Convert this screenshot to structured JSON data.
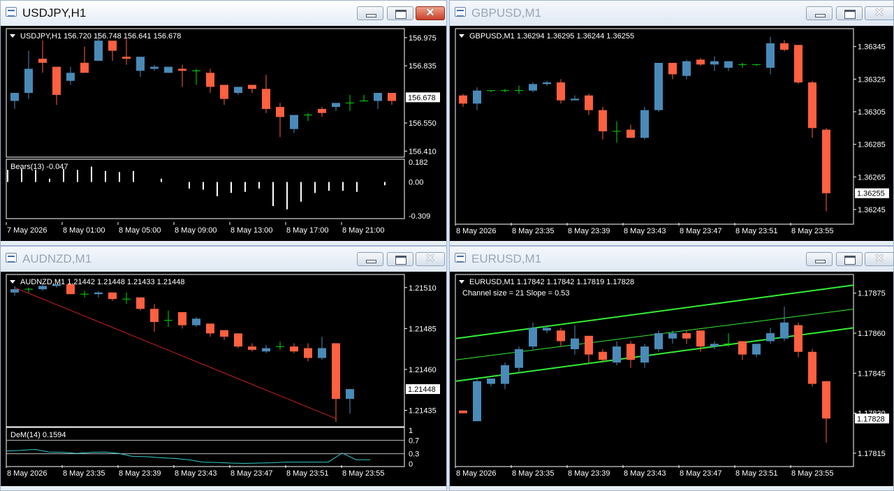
{
  "colors": {
    "bull": "#4a8ab8",
    "bear": "#ff6040",
    "doji": "#00dd00",
    "bg": "#000000",
    "grid": "#ffffff",
    "axis_text": "#ffffff",
    "channel": "#33ee33",
    "trend": "#cc2222",
    "dem": "#33cccc"
  },
  "windows": [
    {
      "id": "usdjpy",
      "title": "USDJPY,H1",
      "active": true,
      "header": "USDJPY,H1  156.720 156.748 156.641 156.678",
      "price_labels": [
        "156.975",
        "156.835",
        "156.550",
        "156.410"
      ],
      "current_price": "156.678",
      "indicator": {
        "label": "Bears(13) -0.047",
        "levels": [
          "0.182",
          "0.00",
          "-0.309"
        ],
        "values": [
          0.11,
          0.12,
          0.11,
          0.03,
          0.12,
          0.11,
          0.14,
          0.1,
          0.09,
          0.1,
          0.0,
          0.03,
          0.0,
          -0.06,
          -0.07,
          -0.13,
          -0.1,
          -0.09,
          -0.06,
          -0.22,
          -0.25,
          -0.18,
          -0.1,
          -0.08,
          -0.08,
          -0.09,
          0.0,
          -0.03,
          0.0
        ]
      },
      "time_labels": [
        "7 May 2026",
        "8 May 01:00",
        "8 May 05:00",
        "8 May 09:00",
        "8 May 13:00",
        "8 May 17:00",
        "8 May 21:00"
      ],
      "ohlc": [
        [
          156.66,
          156.7,
          156.62,
          156.7
        ],
        [
          156.7,
          156.91,
          156.67,
          156.82
        ],
        [
          156.87,
          156.96,
          156.8,
          156.85
        ],
        [
          156.83,
          156.75,
          156.64,
          156.69
        ],
        [
          156.76,
          156.83,
          156.74,
          156.8
        ],
        [
          156.85,
          156.93,
          156.8,
          156.8
        ],
        [
          156.86,
          157.0,
          156.88,
          156.96
        ],
        [
          156.96,
          156.95,
          156.86,
          156.91
        ],
        [
          156.88,
          156.97,
          156.84,
          156.87
        ],
        [
          156.81,
          156.85,
          156.78,
          156.88
        ],
        [
          156.82,
          156.84,
          156.81,
          156.83
        ],
        [
          156.8,
          156.82,
          156.8,
          156.83
        ],
        [
          156.82,
          156.84,
          156.73,
          156.81
        ],
        [
          156.81,
          156.82,
          156.74,
          156.81
        ],
        [
          156.8,
          156.82,
          156.7,
          156.73
        ],
        [
          156.74,
          156.7,
          156.64,
          156.67
        ],
        [
          156.7,
          156.7,
          156.69,
          156.73
        ],
        [
          156.74,
          156.74,
          156.7,
          156.72
        ],
        [
          156.72,
          156.79,
          156.6,
          156.62
        ],
        [
          156.63,
          156.65,
          156.48,
          156.58
        ],
        [
          156.52,
          156.56,
          156.5,
          156.59
        ],
        [
          156.59,
          156.6,
          156.56,
          156.59
        ],
        [
          156.62,
          156.63,
          156.58,
          156.6
        ],
        [
          156.63,
          156.65,
          156.61,
          156.65
        ],
        [
          156.65,
          156.69,
          156.61,
          156.65
        ],
        [
          156.66,
          156.69,
          156.66,
          156.66
        ],
        [
          156.66,
          156.7,
          156.62,
          156.7
        ],
        [
          156.7,
          156.7,
          156.64,
          156.66
        ]
      ],
      "ylim": [
        156.38,
        157.02
      ]
    },
    {
      "id": "gbpusd",
      "title": "GBPUSD,M1",
      "active": false,
      "header": "GBPUSD,M1  1.36294 1.36295 1.36244 1.36255",
      "price_labels": [
        "1.36345",
        "1.36325",
        "1.36305",
        "1.36285",
        "1.36265",
        "1.36245"
      ],
      "current_price": "1.36255",
      "time_labels": [
        "8 May 2026",
        "8 May 23:35",
        "8 May 23:39",
        "8 May 23:43",
        "8 May 23:47",
        "8 May 23:51",
        "8 May 23:55"
      ],
      "ohlc": [
        [
          1.36315,
          1.36316,
          1.36308,
          1.3631
        ],
        [
          1.3631,
          1.3632,
          1.36306,
          1.36318
        ],
        [
          1.36318,
          1.36318,
          1.36317,
          1.36318
        ],
        [
          1.36318,
          1.36319,
          1.36317,
          1.36318
        ],
        [
          1.36318,
          1.36321,
          1.36316,
          1.36318
        ],
        [
          1.36318,
          1.36323,
          1.36317,
          1.36322
        ],
        [
          1.36322,
          1.36324,
          1.36321,
          1.36323
        ],
        [
          1.36323,
          1.36325,
          1.3631,
          1.36312
        ],
        [
          1.36312,
          1.36315,
          1.36312,
          1.36313
        ],
        [
          1.36315,
          1.36316,
          1.36303,
          1.36306
        ],
        [
          1.36306,
          1.36308,
          1.36288,
          1.36293
        ],
        [
          1.36293,
          1.36299,
          1.36286,
          1.36293
        ],
        [
          1.36294,
          1.36297,
          1.36289,
          1.36289
        ],
        [
          1.36289,
          1.36308,
          1.36288,
          1.36306
        ],
        [
          1.36306,
          1.36335,
          1.36305,
          1.36335
        ],
        [
          1.36335,
          1.36334,
          1.36325,
          1.36328
        ],
        [
          1.36327,
          1.36337,
          1.36325,
          1.36336
        ],
        [
          1.36337,
          1.36338,
          1.36333,
          1.36334
        ],
        [
          1.36334,
          1.36339,
          1.3633,
          1.36336
        ],
        [
          1.36332,
          1.36336,
          1.3633,
          1.36336
        ],
        [
          1.36334,
          1.36335,
          1.36332,
          1.36334
        ],
        [
          1.36334,
          1.36334,
          1.36333,
          1.36334
        ],
        [
          1.36332,
          1.36351,
          1.36328,
          1.36347
        ],
        [
          1.36347,
          1.36349,
          1.36342,
          1.36343
        ],
        [
          1.36346,
          1.36346,
          1.36322,
          1.36323
        ],
        [
          1.36323,
          1.36324,
          1.36289,
          1.36295
        ],
        [
          1.36294,
          1.36295,
          1.36244,
          1.36255
        ]
      ],
      "ylim": [
        1.36236,
        1.36356
      ]
    },
    {
      "id": "audnzd",
      "title": "AUDNZD,M1",
      "active": false,
      "header": "AUDNZD,M1  1.21442 1.21448 1.21433 1.21448",
      "price_labels": [
        "1.21510",
        "1.21485",
        "1.21460",
        "1.21435"
      ],
      "current_price": "1.21448",
      "indicator": {
        "label": "DeM(14) 0.1594",
        "levels": [
          "1",
          "0.7",
          "0.3",
          "0"
        ],
        "values": [
          0.38,
          0.4,
          0.43,
          0.35,
          0.34,
          0.31,
          0.34,
          0.35,
          0.31,
          0.22,
          0.21,
          0.18,
          0.16,
          0.12,
          0.05,
          0.04,
          0.02,
          0.01,
          0.02,
          0.03,
          0.05,
          0.05,
          0.05,
          0.05,
          0.32,
          0.12,
          0.12
        ]
      },
      "time_labels": [
        "8 May 2026",
        "8 May 23:35",
        "8 May 23:39",
        "8 May 23:43",
        "8 May 23:47",
        "8 May 23:51",
        "8 May 23:55"
      ],
      "ohlc": [
        [
          1.21507,
          1.21511,
          1.21505,
          1.21509
        ],
        [
          1.21509,
          1.2151,
          1.21507,
          1.21509
        ],
        [
          1.21509,
          1.21512,
          1.21508,
          1.21511
        ],
        [
          1.21511,
          1.21512,
          1.2151,
          1.21512
        ],
        [
          1.21512,
          1.21512,
          1.21506,
          1.21506
        ],
        [
          1.21506,
          1.21508,
          1.21504,
          1.21506
        ],
        [
          1.21506,
          1.21508,
          1.21504,
          1.21507
        ],
        [
          1.21507,
          1.21507,
          1.21502,
          1.21503
        ],
        [
          1.21503,
          1.21507,
          1.215,
          1.21503
        ],
        [
          1.21504,
          1.21504,
          1.21496,
          1.21497
        ],
        [
          1.21497,
          1.215,
          1.21483,
          1.21489
        ],
        [
          1.2149,
          1.21496,
          1.21486,
          1.2149
        ],
        [
          1.21495,
          1.21495,
          1.21485,
          1.21487
        ],
        [
          1.21487,
          1.21492,
          1.21486,
          1.21491
        ],
        [
          1.21488,
          1.21488,
          1.2148,
          1.21482
        ],
        [
          1.21484,
          1.21484,
          1.21478,
          1.2148
        ],
        [
          1.21482,
          1.21482,
          1.21473,
          1.21474
        ],
        [
          1.21474,
          1.21476,
          1.21471,
          1.21472
        ],
        [
          1.21471,
          1.21475,
          1.2147,
          1.21473
        ],
        [
          1.21474,
          1.21477,
          1.21472,
          1.21474
        ],
        [
          1.21474,
          1.21476,
          1.2147,
          1.21471
        ],
        [
          1.21473,
          1.21476,
          1.21465,
          1.21467
        ],
        [
          1.21467,
          1.2148,
          1.21466,
          1.21473
        ],
        [
          1.21476,
          1.21476,
          1.21428,
          1.21442
        ],
        [
          1.21442,
          1.21448,
          1.21433,
          1.21448
        ]
      ],
      "ylim": [
        1.21425,
        1.21518
      ],
      "trendline": {
        "from": [
          0,
          1.2151
        ],
        "to": [
          23,
          1.2143
        ]
      }
    },
    {
      "id": "eurusd",
      "title": "EURUSD,M1",
      "active": false,
      "header": "EURUSD,M1  1.17842 1.17842 1.17819 1.17828",
      "subheader": "Channel size = 21 Slope = 0.53",
      "price_labels": [
        "1.17875",
        "1.17860",
        "1.17845",
        "1.17830",
        "1.17815"
      ],
      "current_price": "1.17828",
      "time_labels": [
        "8 May 2026",
        "8 May 23:35",
        "8 May 23:39",
        "8 May 23:43",
        "8 May 23:47",
        "8 May 23:51",
        "8 May 23:55"
      ],
      "ohlc": [
        [
          1.17831,
          1.17831,
          1.1783,
          1.1783
        ],
        [
          1.17827,
          1.17843,
          1.17827,
          1.17842
        ],
        [
          1.17841,
          1.17843,
          1.1784,
          1.17843
        ],
        [
          1.17841,
          1.17849,
          1.17839,
          1.17848
        ],
        [
          1.17847,
          1.17855,
          1.17845,
          1.17854
        ],
        [
          1.17855,
          1.17864,
          1.17854,
          1.17862
        ],
        [
          1.17861,
          1.17863,
          1.1786,
          1.17862
        ],
        [
          1.17861,
          1.17862,
          1.17855,
          1.17857
        ],
        [
          1.17854,
          1.17863,
          1.17852,
          1.17858
        ],
        [
          1.17859,
          1.17859,
          1.17849,
          1.17852
        ],
        [
          1.17853,
          1.17854,
          1.17849,
          1.1785
        ],
        [
          1.17849,
          1.17857,
          1.17848,
          1.17855
        ],
        [
          1.17856,
          1.17857,
          1.17847,
          1.1785
        ],
        [
          1.17849,
          1.17856,
          1.17847,
          1.17855
        ],
        [
          1.17854,
          1.17861,
          1.17853,
          1.1786
        ],
        [
          1.17858,
          1.17861,
          1.17856,
          1.1786
        ],
        [
          1.1786,
          1.17861,
          1.17856,
          1.17858
        ],
        [
          1.17861,
          1.17861,
          1.17853,
          1.17855
        ],
        [
          1.17855,
          1.17857,
          1.17854,
          1.17856
        ],
        [
          1.17856,
          1.1786,
          1.17855,
          1.17856
        ],
        [
          1.17857,
          1.17857,
          1.1785,
          1.17852
        ],
        [
          1.17852,
          1.17856,
          1.17851,
          1.17856
        ],
        [
          1.17857,
          1.17862,
          1.17856,
          1.1786
        ],
        [
          1.17858,
          1.1787,
          1.17857,
          1.17864
        ],
        [
          1.17863,
          1.17864,
          1.17851,
          1.17853
        ],
        [
          1.17853,
          1.17854,
          1.1784,
          1.17841
        ],
        [
          1.17842,
          1.17842,
          1.17819,
          1.17828
        ]
      ],
      "ylim": [
        1.1781,
        1.17882
      ],
      "channel": {
        "upper": [
          1.17858,
          1.17878
        ],
        "mid": [
          1.1785,
          1.17869
        ],
        "lower": [
          1.17842,
          1.17862
        ]
      }
    }
  ]
}
